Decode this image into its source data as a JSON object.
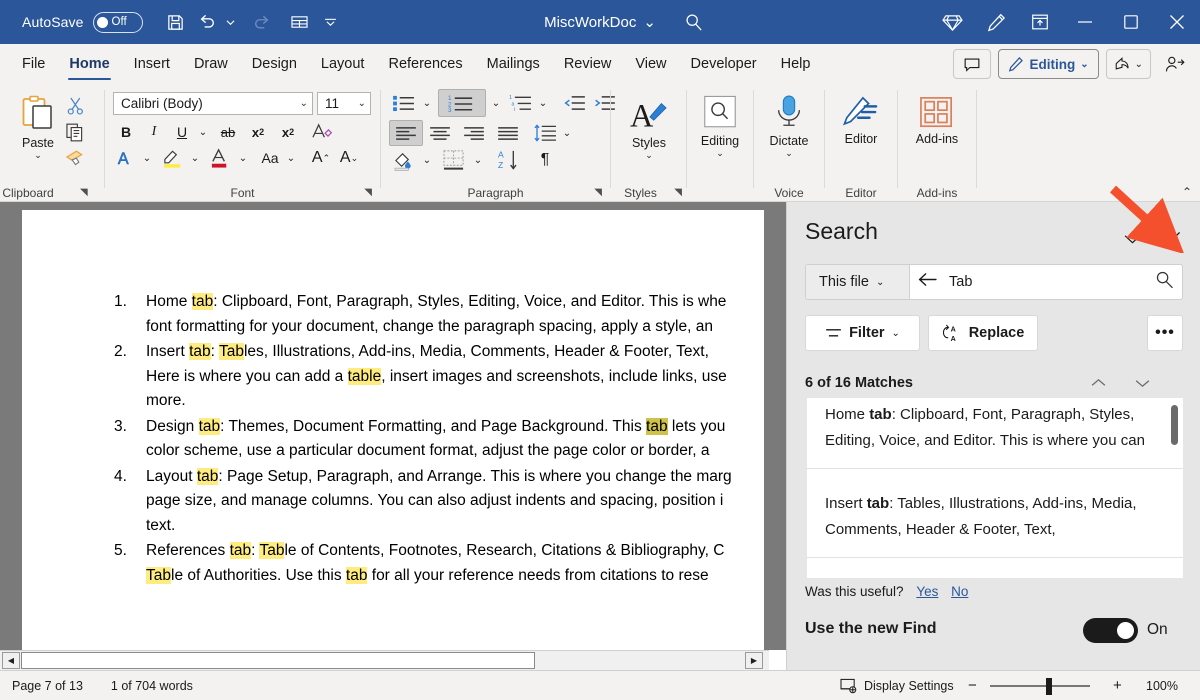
{
  "titlebar": {
    "autosave_label": "AutoSave",
    "autosave_state": "Off",
    "doc_title": "MiscWorkDoc",
    "quick_access": [
      "save-icon",
      "undo-icon",
      "redo-icon",
      "table-icon",
      "more-icon"
    ],
    "right_icons": [
      "diamond-icon",
      "pen-icon",
      "upload-icon"
    ],
    "window_buttons": [
      "minimize",
      "maximize",
      "close"
    ]
  },
  "tabs": [
    {
      "label": "File",
      "active": false
    },
    {
      "label": "Home",
      "active": true
    },
    {
      "label": "Insert",
      "active": false
    },
    {
      "label": "Draw",
      "active": false
    },
    {
      "label": "Design",
      "active": false
    },
    {
      "label": "Layout",
      "active": false
    },
    {
      "label": "References",
      "active": false
    },
    {
      "label": "Mailings",
      "active": false
    },
    {
      "label": "Review",
      "active": false
    },
    {
      "label": "View",
      "active": false
    },
    {
      "label": "Developer",
      "active": false
    },
    {
      "label": "Help",
      "active": false
    }
  ],
  "tabstrip_right": {
    "comments_label": "",
    "editing_label": "Editing",
    "share_label": "",
    "collapse_caret": "⌃"
  },
  "ribbon": {
    "groups": [
      {
        "name": "Clipboard",
        "label": "Clipboard"
      },
      {
        "name": "Font",
        "label": "Font"
      },
      {
        "name": "Paragraph",
        "label": "Paragraph"
      },
      {
        "name": "Styles",
        "label": "Styles"
      },
      {
        "name": "Editing",
        "label": ""
      },
      {
        "name": "Voice",
        "label": "Voice"
      },
      {
        "name": "Editor",
        "label": "Editor"
      },
      {
        "name": "Add-ins",
        "label": "Add-ins"
      }
    ],
    "paste_label": "Paste",
    "font_name": "Calibri (Body)",
    "font_size": "11",
    "styles_label": "Styles",
    "editing_label": "Editing",
    "dictate_label": "Dictate",
    "editor_label": "Editor",
    "addins_label": "Add-ins"
  },
  "document": {
    "items": [
      {
        "num": "1.",
        "segments": [
          {
            "t": "Home ",
            "hl": "none"
          },
          {
            "t": "tab",
            "hl": "yellow"
          },
          {
            "t": ": Clipboard, Font, Paragraph, Styles, Editing, Voice, and Editor. This is whe",
            "hl": "none"
          },
          {
            "t": "\nfont formatting for your document, change the paragraph spacing, apply a style, an",
            "hl": "none"
          }
        ]
      },
      {
        "num": "2.",
        "segments": [
          {
            "t": "Insert ",
            "hl": "none"
          },
          {
            "t": "tab",
            "hl": "yellow"
          },
          {
            "t": ": ",
            "hl": "none"
          },
          {
            "t": "Tab",
            "hl": "yellow"
          },
          {
            "t": "les, Illustrations, Add-ins, Media, Comments, Header & Footer, Text,",
            "hl": "none"
          },
          {
            "t": "\nHere is where you can add a ",
            "hl": "none"
          },
          {
            "t": "table",
            "hl": "yellow"
          },
          {
            "t": ", insert images and screenshots, include links, use",
            "hl": "none"
          },
          {
            "t": "\nmore.",
            "hl": "none"
          }
        ]
      },
      {
        "num": "3.",
        "segments": [
          {
            "t": "Design ",
            "hl": "none"
          },
          {
            "t": "tab",
            "hl": "yellow"
          },
          {
            "t": ": Themes, Document Formatting, and Page Background. This ",
            "hl": "none"
          },
          {
            "t": "tab",
            "hl": "current"
          },
          {
            "t": " lets you",
            "hl": "none"
          },
          {
            "t": "\ncolor scheme, use a particular document format, adjust the page color or border, a",
            "hl": "none"
          }
        ]
      },
      {
        "num": "4.",
        "segments": [
          {
            "t": "Layout ",
            "hl": "none"
          },
          {
            "t": "tab",
            "hl": "yellow"
          },
          {
            "t": ": Page Setup, Paragraph, and Arrange. This is where you change the marg",
            "hl": "none"
          },
          {
            "t": "\npage size, and manage columns. You can also adjust indents and spacing, position i",
            "hl": "none"
          },
          {
            "t": "\ntext.",
            "hl": "none"
          }
        ]
      },
      {
        "num": "5.",
        "segments": [
          {
            "t": "References ",
            "hl": "none"
          },
          {
            "t": "tab",
            "hl": "yellow"
          },
          {
            "t": ": ",
            "hl": "none"
          },
          {
            "t": "Tab",
            "hl": "yellow"
          },
          {
            "t": "le of Contents, Footnotes, Research, Citations & Bibliography, C",
            "hl": "none"
          },
          {
            "t": "\n",
            "hl": "none"
          },
          {
            "t": "Tab",
            "hl": "yellow"
          },
          {
            "t": "le of Authorities. Use this ",
            "hl": "none"
          },
          {
            "t": "tab",
            "hl": "yellow"
          },
          {
            "t": " for all your reference needs from citations to rese",
            "hl": "none"
          }
        ]
      }
    ]
  },
  "search_pane": {
    "title": "Search",
    "scope_label": "This file",
    "query": "Tab",
    "filter_label": "Filter",
    "replace_label": "Replace",
    "more_label": "•••",
    "match_count": "6 of 16 Matches",
    "results": [
      {
        "prefix": "Home ",
        "bold": "tab",
        "suffix": ": Clipboard, Font, Paragraph, Styles, Editing, Voice, and Editor. This is where you can"
      },
      {
        "prefix": "Insert ",
        "bold": "tab",
        "suffix": ": Tables, Illustrations, Add-ins, Media, Comments, Header & Footer, Text,"
      }
    ],
    "useful_question": "Was this useful?",
    "useful_yes": "Yes",
    "useful_no": "No",
    "newfind_label": "Use the new Find",
    "newfind_state": "On"
  },
  "status": {
    "page": "Page 7 of 13",
    "words": "1 of 704 words",
    "display_settings": "Display Settings",
    "zoom": "100%",
    "zoom_out": "−",
    "zoom_in": "+"
  },
  "colors": {
    "titlebar": "#2b579a",
    "ribbon": "#f3f2f1",
    "accent": "#2b579a",
    "highlight": "#ffec80",
    "highlight_current": "#cfc24a",
    "arrow": "#f4502d"
  }
}
